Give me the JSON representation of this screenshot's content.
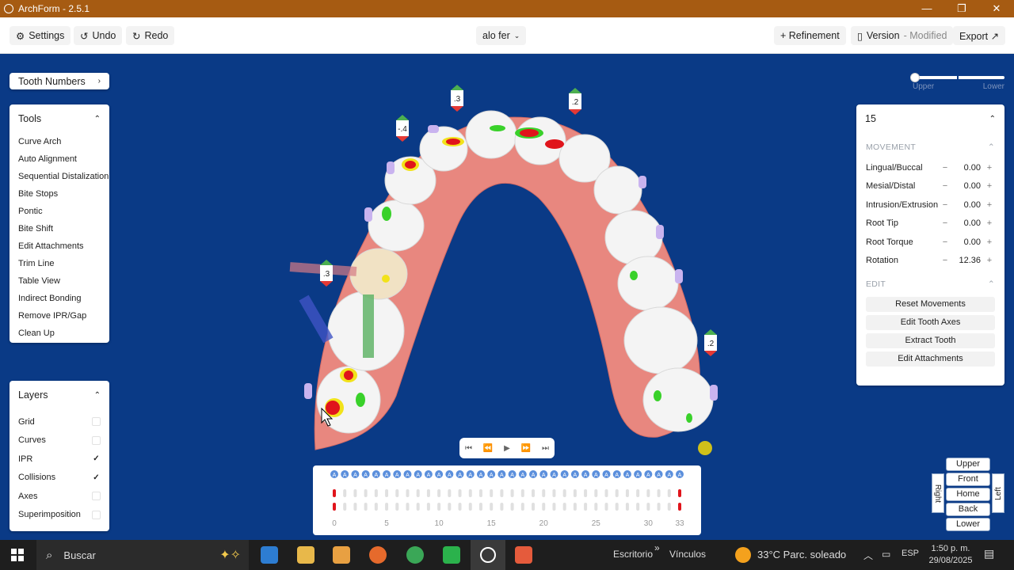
{
  "window": {
    "title": "ArchForm - 2.5.1",
    "controls": {
      "minimize": "—",
      "maximize": "❐",
      "close": "✕"
    }
  },
  "toolbar": {
    "settings": "Settings",
    "undo": "Undo",
    "redo": "Redo",
    "patient": "alo fer",
    "refinement": "+ Refinement",
    "version": "Version",
    "version_status": "- Modified",
    "export": "Export ↗"
  },
  "tooth_numbers": {
    "label": "Tooth Numbers"
  },
  "tools": {
    "title": "Tools",
    "items": [
      "Curve Arch",
      "Auto Alignment",
      "Sequential Distalization",
      "Bite Stops",
      "Pontic",
      "Bite Shift",
      "Edit Attachments",
      "Trim Line",
      "Table View",
      "Indirect Bonding",
      "Remove IPR/Gap",
      "Clean Up"
    ]
  },
  "layers": {
    "title": "Layers",
    "items": [
      {
        "label": "Grid",
        "checked": false
      },
      {
        "label": "Curves",
        "checked": false
      },
      {
        "label": "IPR",
        "checked": true
      },
      {
        "label": "Collisions",
        "checked": true
      },
      {
        "label": "Axes",
        "checked": false
      },
      {
        "label": "Superimposition",
        "checked": false
      }
    ]
  },
  "arch_slider": {
    "upper": "Upper",
    "lower": "Lower"
  },
  "tooth_panel": {
    "tooth": "15",
    "movement_title": "MOVEMENT",
    "movements": [
      {
        "label": "Lingual/Buccal",
        "value": "0.00"
      },
      {
        "label": "Mesial/Distal",
        "value": "0.00"
      },
      {
        "label": "Intrusion/Extrusion",
        "value": "0.00"
      },
      {
        "label": "Root Tip",
        "value": "0.00"
      },
      {
        "label": "Root Torque",
        "value": "0.00"
      },
      {
        "label": "Rotation",
        "value": "12.36"
      }
    ],
    "edit_title": "EDIT",
    "edit_buttons": [
      "Reset Movements",
      "Edit Tooth Axes",
      "Extract Tooth",
      "Edit Attachments"
    ]
  },
  "ipr_markers": [
    ".3",
    ".2",
    "-.4",
    ".3",
    ".2"
  ],
  "timeline": {
    "ticks": [
      "0",
      "5",
      "10",
      "15",
      "20",
      "25",
      "30",
      "33"
    ],
    "stages": 34
  },
  "view_cube": {
    "upper": "Upper",
    "front": "Front",
    "home": "Home",
    "back": "Back",
    "lower": "Lower",
    "right": "Right",
    "left": "Left"
  },
  "taskbar": {
    "search_placeholder": "Buscar",
    "desktop": "Escritorio",
    "links": "Vínculos",
    "weather": "33°C  Parc. soleado",
    "language": "ESP",
    "time": "1:50 p. m.",
    "date": "29/08/2025"
  },
  "colors": {
    "viewport": "#0a3a86",
    "titlebar": "#a65b12",
    "gum": "#e8877f",
    "collision_red": "#e0141b",
    "collision_green": "#39d12a",
    "collision_yellow": "#f2e21a"
  }
}
